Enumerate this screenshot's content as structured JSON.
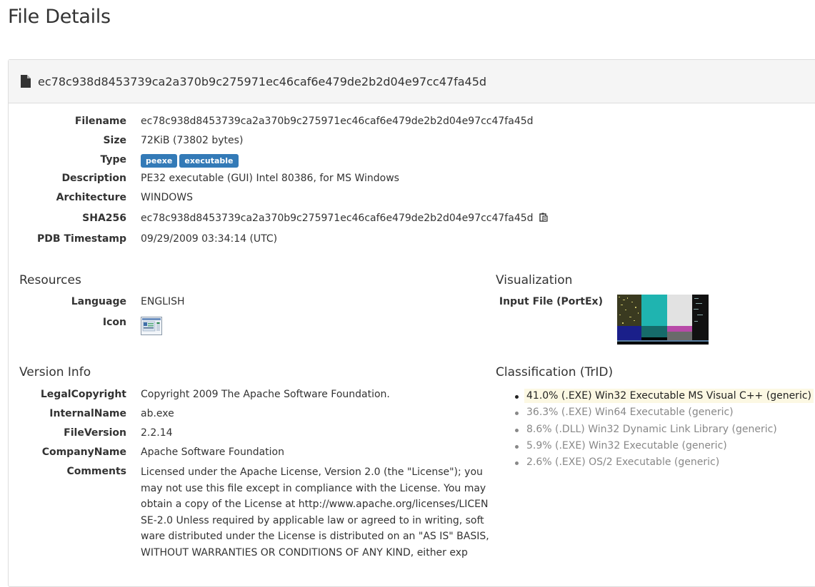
{
  "page": {
    "title": "File Details"
  },
  "panel": {
    "hash_title": "ec78c938d8453739ca2a370b9c275971ec46caf6e479de2b2d04e97cc47fa45d"
  },
  "details": {
    "filename": {
      "label": "Filename",
      "value": "ec78c938d8453739ca2a370b9c275971ec46caf6e479de2b2d04e97cc47fa45d"
    },
    "size": {
      "label": "Size",
      "value": "72KiB (73802 bytes)"
    },
    "type": {
      "label": "Type",
      "badges": [
        "peexe",
        "executable"
      ]
    },
    "description": {
      "label": "Description",
      "value": "PE32 executable (GUI) Intel 80386, for MS Windows"
    },
    "architecture": {
      "label": "Architecture",
      "value": "WINDOWS"
    },
    "sha256": {
      "label": "SHA256",
      "value": "ec78c938d8453739ca2a370b9c275971ec46caf6e479de2b2d04e97cc47fa45d"
    },
    "pdb_timestamp": {
      "label": "PDB Timestamp",
      "value": "09/29/2009 03:34:14 (UTC)"
    }
  },
  "resources": {
    "title": "Resources",
    "language": {
      "label": "Language",
      "value": "ENGLISH"
    },
    "icon": {
      "label": "Icon"
    }
  },
  "visualization": {
    "title": "Visualization",
    "input_file_label": "Input File (PortEx)"
  },
  "version_info": {
    "title": "Version Info",
    "legal_copyright": {
      "label": "LegalCopyright",
      "value": "Copyright 2009 The Apache Software Foundation."
    },
    "internal_name": {
      "label": "InternalName",
      "value": "ab.exe"
    },
    "file_version": {
      "label": "FileVersion",
      "value": "2.2.14"
    },
    "company_name": {
      "label": "CompanyName",
      "value": "Apache Software Foundation"
    },
    "comments": {
      "label": "Comments",
      "lines": [
        "Licensed under the Apache License, Version 2.0 (the \"License\"); you",
        "may not use this file except in compliance with the License. You may",
        "obtain a copy of the License at http://www.apache.org/licenses/LICEN",
        "SE-2.0 Unless required by applicable law or agreed to in writing, soft",
        "ware distributed under the License is distributed on an \"AS IS\" BASIS,",
        "WITHOUT WARRANTIES OR CONDITIONS OF ANY KIND, either exp"
      ]
    }
  },
  "classification": {
    "title": "Classification (TrID)",
    "items": [
      "41.0% (.EXE) Win32 Executable MS Visual C++ (generic)",
      "36.3% (.EXE) Win64 Executable (generic)",
      "8.6% (.DLL) Win32 Dynamic Link Library (generic)",
      "5.9% (.EXE) Win32 Executable (generic)",
      "2.6% (.EXE) OS/2 Executable (generic)"
    ]
  },
  "colors": {
    "badge": "#337ab7",
    "highlight": "#fcf8e3",
    "panel_heading_bg": "#f5f5f5",
    "muted_text": "#888888"
  },
  "icons": {
    "file": "file-icon",
    "copy": "clipboard-copy-icon",
    "resource_icon": "application-window-icon"
  }
}
